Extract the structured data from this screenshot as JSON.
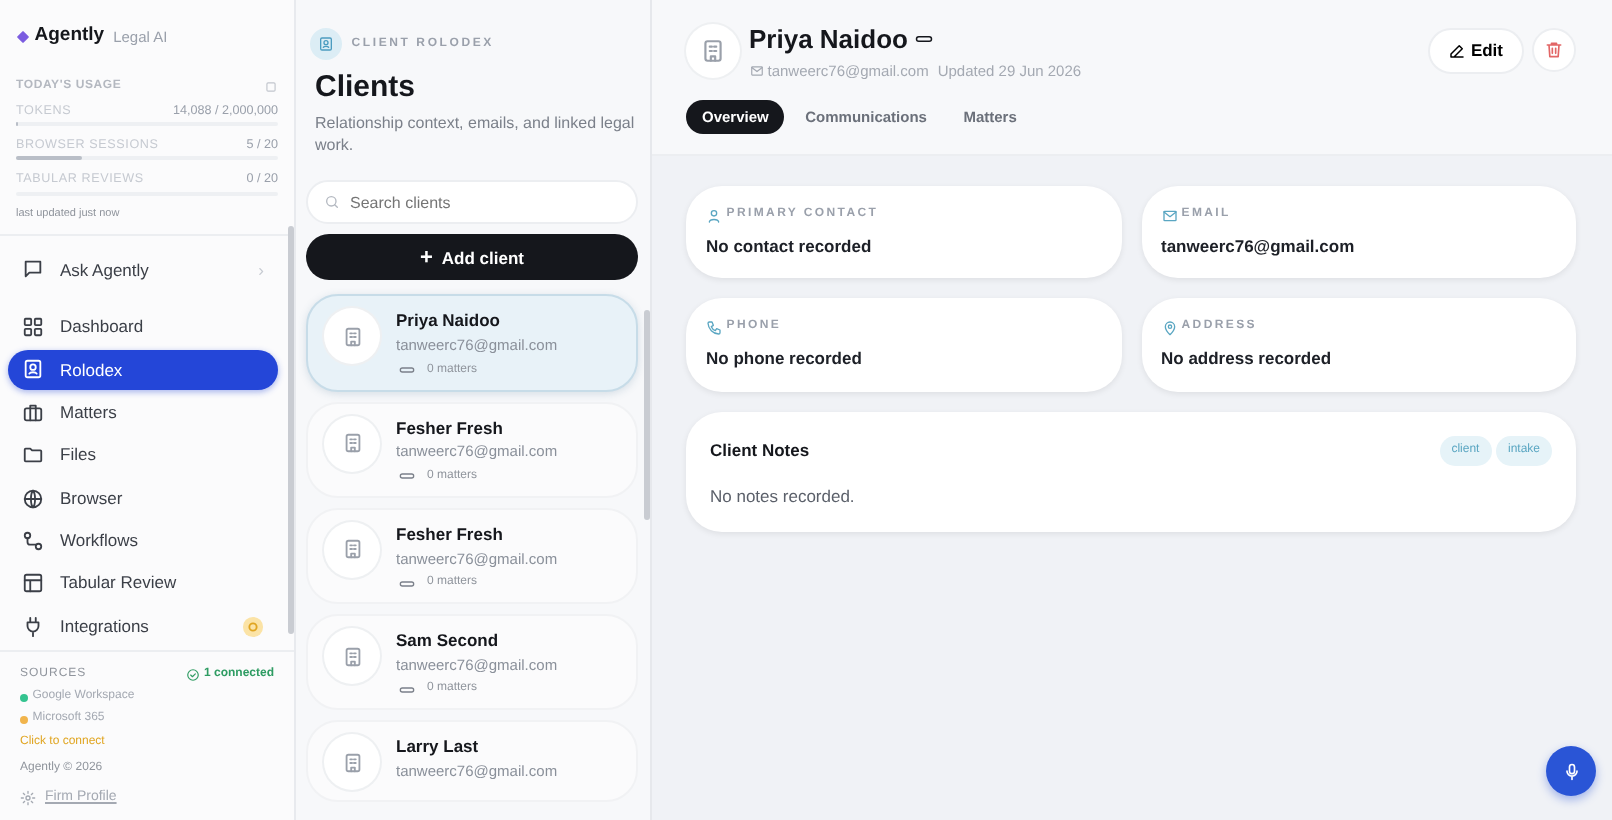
{
  "brand": {
    "name": "Agently",
    "tagline": "Legal AI"
  },
  "usage": {
    "title": "TODAY'S USAGE",
    "meters": [
      {
        "label": "TOKENS",
        "reading": "14,088 / 2,000,000",
        "level": 0.007
      },
      {
        "label": "BROWSER SESSIONS",
        "reading": "5 / 20",
        "level": 0.25
      },
      {
        "label": "TABULAR REVIEWS",
        "reading": "0 / 20",
        "level": 0
      }
    ],
    "updated": "last updated just now"
  },
  "ask": {
    "label": "Ask Agently",
    "chevron": "›"
  },
  "nav": [
    {
      "label": "Dashboard",
      "selected": false
    },
    {
      "label": "Rolodex",
      "selected": true
    },
    {
      "label": "Matters",
      "selected": false
    },
    {
      "label": "Files",
      "selected": false
    },
    {
      "label": "Browser",
      "selected": false
    },
    {
      "label": "Workflows",
      "selected": false
    },
    {
      "label": "Tabular Review",
      "selected": false
    },
    {
      "label": "Integrations",
      "selected": false,
      "warning": true
    }
  ],
  "sources": {
    "title": "SOURCES",
    "status": "1 connected",
    "items": [
      {
        "name": "Google Workspace",
        "color": "#34c38f"
      },
      {
        "name": "Microsoft 365",
        "color": "#f1b44c"
      }
    ],
    "action": "Click to connect"
  },
  "footer": {
    "copyright": "Agently © 2026",
    "profile": "Firm Profile"
  },
  "list": {
    "eyebrow": "CLIENT ROLODEX",
    "title": "Clients",
    "subtitle": "Relationship context, emails, and linked legal work.",
    "search": {
      "placeholder": "Search clients"
    },
    "add": {
      "icon": "+",
      "label": "Add client"
    },
    "clients": [
      {
        "name": "Priya Naidoo",
        "email": "tanweerc76@gmail.com",
        "matters": "0 matters",
        "selected": true
      },
      {
        "name": "Fesher Fresh",
        "email": "tanweerc76@gmail.com",
        "matters": "0 matters",
        "selected": false
      },
      {
        "name": "Fesher Fresh",
        "email": "tanweerc76@gmail.com",
        "matters": "0 matters",
        "selected": false
      },
      {
        "name": "Sam Second",
        "email": "tanweerc76@gmail.com",
        "matters": "0 matters",
        "selected": false
      },
      {
        "name": "Larry Last",
        "email": "tanweerc76@gmail.com",
        "selected": false
      }
    ]
  },
  "detail": {
    "name": "Priya Naidoo",
    "email": "tanweerc76@gmail.com",
    "updated": "Updated 29 Jun 2026",
    "edit": "Edit",
    "tabs": [
      {
        "label": "Overview",
        "selected": true
      },
      {
        "label": "Communications",
        "selected": false
      },
      {
        "label": "Matters",
        "selected": false
      }
    ],
    "fields": [
      {
        "kind": "contact",
        "label": "PRIMARY CONTACT",
        "value": "No contact recorded"
      },
      {
        "kind": "email",
        "label": "EMAIL",
        "value": "tanweerc76@gmail.com"
      },
      {
        "kind": "phone",
        "label": "PHONE",
        "value": "No phone recorded"
      },
      {
        "kind": "address",
        "label": "ADDRESS",
        "value": "No address recorded"
      }
    ],
    "notes": {
      "title": "Client Notes",
      "tags": [
        "client",
        "intake"
      ],
      "text": "No notes recorded."
    }
  }
}
